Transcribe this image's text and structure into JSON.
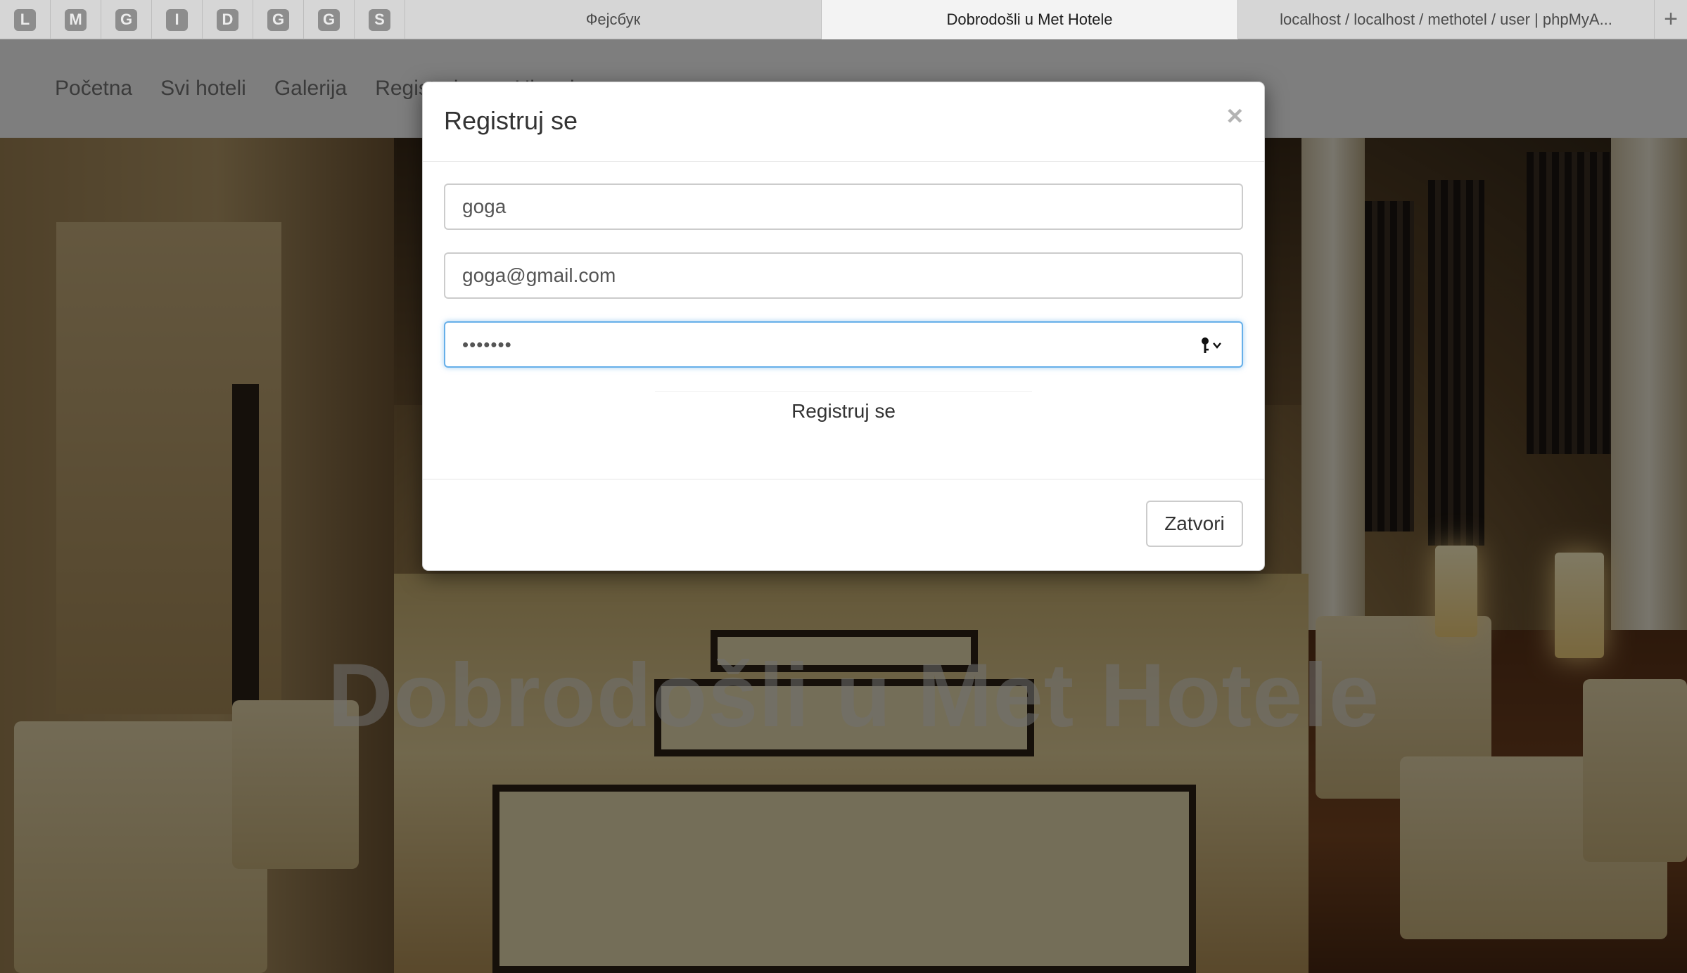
{
  "browser": {
    "pinned_tabs": [
      "L",
      "M",
      "G",
      "I",
      "D",
      "G",
      "G",
      "S"
    ],
    "tabs": [
      {
        "title": "Фејсбук",
        "active": false
      },
      {
        "title": "Dobrodošli u Met Hotele",
        "active": true
      },
      {
        "title": "localhost / localhost / methotel / user | phpMyA...",
        "active": false
      }
    ],
    "new_tab_symbol": "+"
  },
  "nav": {
    "items": [
      "Početna",
      "Svi hoteli",
      "Galerija",
      "Registruj se",
      "Uloguj se"
    ]
  },
  "hero": {
    "title": "Dobrodošli u Met Hotele"
  },
  "modal": {
    "title": "Registruj se",
    "close_symbol": "×",
    "fields": {
      "username_value": "goga",
      "email_value": "goga@gmail.com",
      "password_mask": "•••••••"
    },
    "submit_label": "Registruj se",
    "close_button_label": "Zatvori"
  },
  "icons": {
    "password_autofill": "key-icon",
    "modal_close": "close-icon"
  },
  "colors": {
    "focus_border": "#66afe9",
    "nav_text": "#777777",
    "backdrop": "rgba(0,0,0,0.5)"
  }
}
